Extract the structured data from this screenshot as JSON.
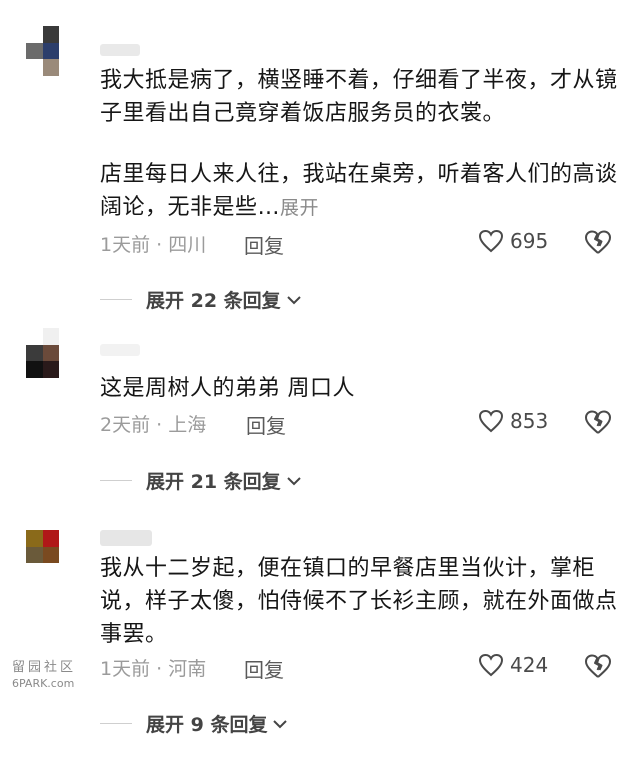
{
  "comments": [
    {
      "avatar_colors": [
        "#ffffff",
        "#3a3a3a",
        "#ffffff",
        "#6b6b6b",
        "#2c3e6b",
        "#ffffff",
        "#ffffff",
        "#9a8a7a",
        "#ffffff"
      ],
      "username_color": "#e9e9e9",
      "paragraph1": "我大抵是病了，横竖睡不着，仔细看了半夜，才从镜子里看出自己竟穿着饭店服务员的衣裳。",
      "paragraph2": "店里每日人来人往，我站在桌旁，听着客人们的高谈阔论，无非是些…",
      "expand_label": "展开",
      "meta": "1天前 · 四川",
      "reply_label": "回复",
      "likes": "695",
      "more_replies": "展开 22 条回复"
    },
    {
      "avatar_colors": [
        "#ffffff",
        "#f0f0f0",
        "#ffffff",
        "#3b3b3b",
        "#6a4a3a",
        "#ffffff",
        "#111111",
        "#2a1a1a",
        "#ffffff"
      ],
      "username_color": "#f2f2f2",
      "paragraph1": "这是周树人的弟弟 周口人",
      "meta": "2天前 · 上海",
      "reply_label": "回复",
      "likes": "853",
      "more_replies": "展开 21 条回复"
    },
    {
      "avatar_colors": [
        "#8a6a1a",
        "#b01818",
        "#ffffff",
        "#6a5a3a",
        "#7a4a20",
        "#ffffff",
        "#ffffff",
        "#ffffff",
        "#ffffff"
      ],
      "username_color": "#e6e6e6",
      "paragraph1": "我从十二岁起，便在镇口的早餐店里当伙计，掌柜说，样子太傻，怕侍候不了长衫主顾，就在外面做点事罢。",
      "meta": "1天前 · 河南",
      "reply_label": "回复",
      "likes": "424",
      "more_replies": "展开 9 条回复"
    }
  ],
  "watermark": {
    "line1": "留园社区",
    "line2": "6PARK.com"
  }
}
